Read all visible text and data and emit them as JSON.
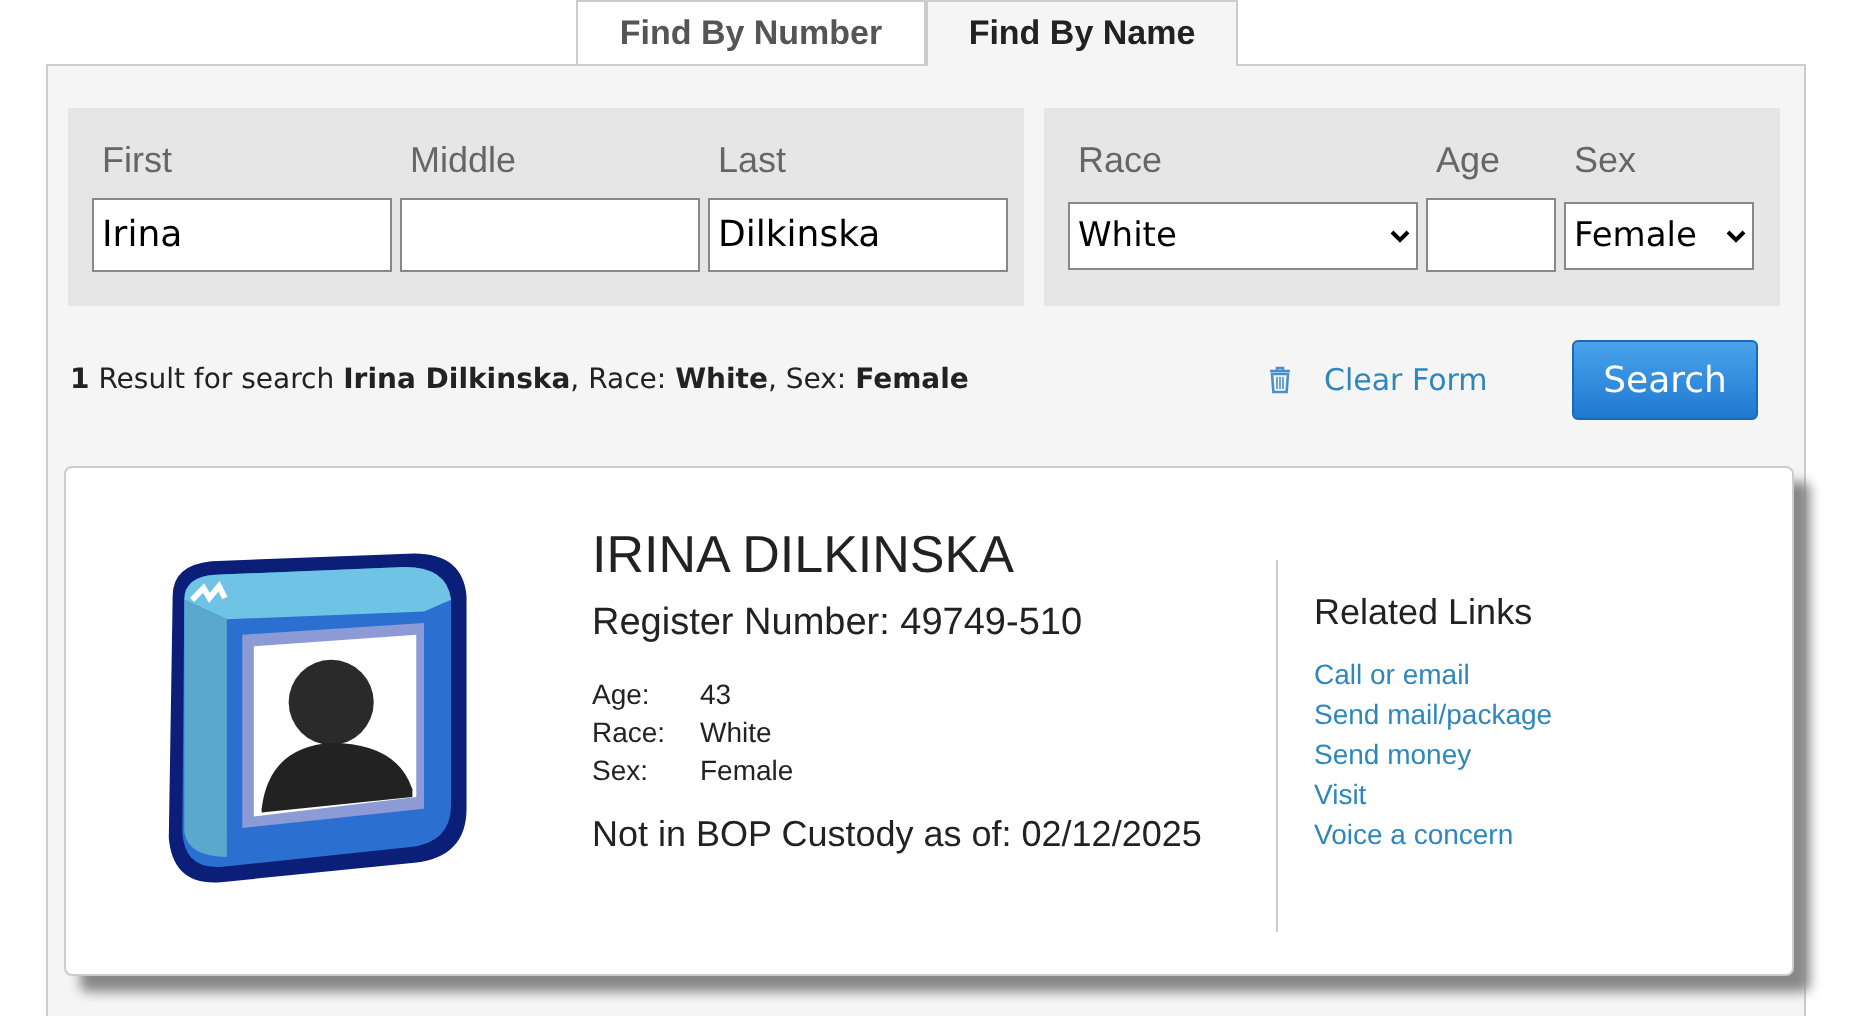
{
  "tabs": [
    {
      "label": "Find By Number",
      "selected": false
    },
    {
      "label": "Find By Name",
      "selected": true
    }
  ],
  "name_fields": [
    {
      "label": "First",
      "value": "Irina"
    },
    {
      "label": "Middle"
    },
    {
      "label": "Last",
      "value": "Dilkinska"
    }
  ],
  "filter_fields": [
    {
      "kind": "select",
      "label": "Race",
      "value": "White"
    },
    {
      "kind": "input",
      "label": "Age"
    },
    {
      "kind": "select",
      "label": "Sex",
      "value": "Female"
    }
  ],
  "summary": "**1** Result for search **Irina Dilkinska**, Race: **White**, Sex: **Female**",
  "clear_button": "Clear Form",
  "search_button": "Search",
  "result": {
    "name": "IRINA DILKINSKA",
    "register": "Register Number: 49749-510",
    "details": [
      {
        "label": "Age:",
        "value": "43"
      },
      {
        "label": "Race:",
        "value": "White"
      },
      {
        "label": "Sex:",
        "value": "Female"
      }
    ],
    "custody": "Not in BOP Custody as of: 02/12/2025",
    "links_title": "Related Links",
    "links": [
      "Call or email",
      "Send mail/package",
      "Send money",
      "Visit",
      "Voice a concern"
    ]
  }
}
